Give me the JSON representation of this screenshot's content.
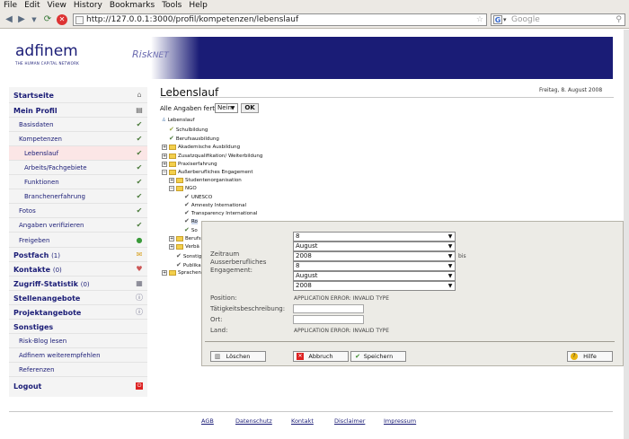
{
  "browser": {
    "menu": [
      "File",
      "Edit",
      "View",
      "History",
      "Bookmarks",
      "Tools",
      "Help"
    ],
    "url": "http://127.0.0.1:3000/profil/kompetenzen/lebenslauf",
    "search_placeholder": "Google"
  },
  "header": {
    "logo": "adfinem",
    "logo_sub": "THE HUMAN CAPITAL NETWORK",
    "risknet_prefix": "Risk",
    "risknet_suffix": "NET"
  },
  "sidebar": {
    "startseite": "Startseite",
    "meinprofil": "Mein Profil",
    "basisdaten": "Basisdaten",
    "kompetenzen": "Kompetenzen",
    "lebenslauf": "Lebenslauf",
    "arbeitsgebiete": "Arbeits/Fachgebiete",
    "funktionen": "Funktionen",
    "branchenerfahrung": "Branchenerfahrung",
    "fotos": "Fotos",
    "angaben": "Angaben verifizieren",
    "freigeben": "Freigeben",
    "postfach": "Postfach",
    "postfach_count": "(1)",
    "kontakte": "Kontakte",
    "kontakte_count": "(0)",
    "zugriff": "Zugriff-Statistik",
    "zugriff_count": "(0)",
    "stellenangebote": "Stellenangebote",
    "projektangebote": "Projektangebote",
    "sonstiges": "Sonstiges",
    "riskblog": "Risk-Blog lesen",
    "weiterempfehlen": "Adfinem weiterempfehlen",
    "referenzen": "Referenzen",
    "logout": "Logout"
  },
  "main": {
    "title": "Lebenslauf",
    "date": "Freitag, 8. August 2008",
    "alle_label": "Alle Angaben fertig:",
    "alle_value": "Nein",
    "ok": "OK"
  },
  "tree": {
    "root": "Lebenslauf",
    "schulbildung": "Schulbildung",
    "berufsausbildung": "Berufsausbildung",
    "akademische": "Akademische Ausbildung",
    "zusatz": "Zusatzqualifikation/ Weiterbildung",
    "praxis": "Praxiserfahrung",
    "ausser": "Außerberufliches Engagement",
    "studenten": "Studentenorganisation",
    "ngo": "NGO",
    "unesco": "UNESCO",
    "amnesty": "Amnesty International",
    "transparency": "Transparency International",
    "ro": "Ro",
    "so": "So",
    "berufs": "Berufs",
    "verbae": "Verbä",
    "sonstig": "Sonstig",
    "publika": "Publika",
    "sprachen": "Sprachen"
  },
  "modal": {
    "zeitraum": "Zeitraum",
    "ausser1": "Ausserberufliches",
    "engagement": "Engagement:",
    "from_day": "8",
    "from_month": "August",
    "from_year": "2008",
    "bis": "bis",
    "to_day": "8",
    "to_month": "August",
    "to_year": "2008",
    "position_label": "Position:",
    "position_value": "APPLICATION ERROR: INVALID TYPE",
    "taetigkeit_label": "Tätigkeitsbeschreibung:",
    "ort_label": "Ort:",
    "land_label": "Land:",
    "land_value": "APPLICATION ERROR: INVALID TYPE",
    "loeschen": "Löschen",
    "abbruch": "Abbruch",
    "speichern": "Speichern",
    "hilfe": "Hilfe"
  },
  "footer": {
    "agb": "AGB",
    "datenschutz": "Datenschutz",
    "kontakt": "Kontakt",
    "disclaimer": "Disclaimer",
    "impressum": "Impressum"
  }
}
